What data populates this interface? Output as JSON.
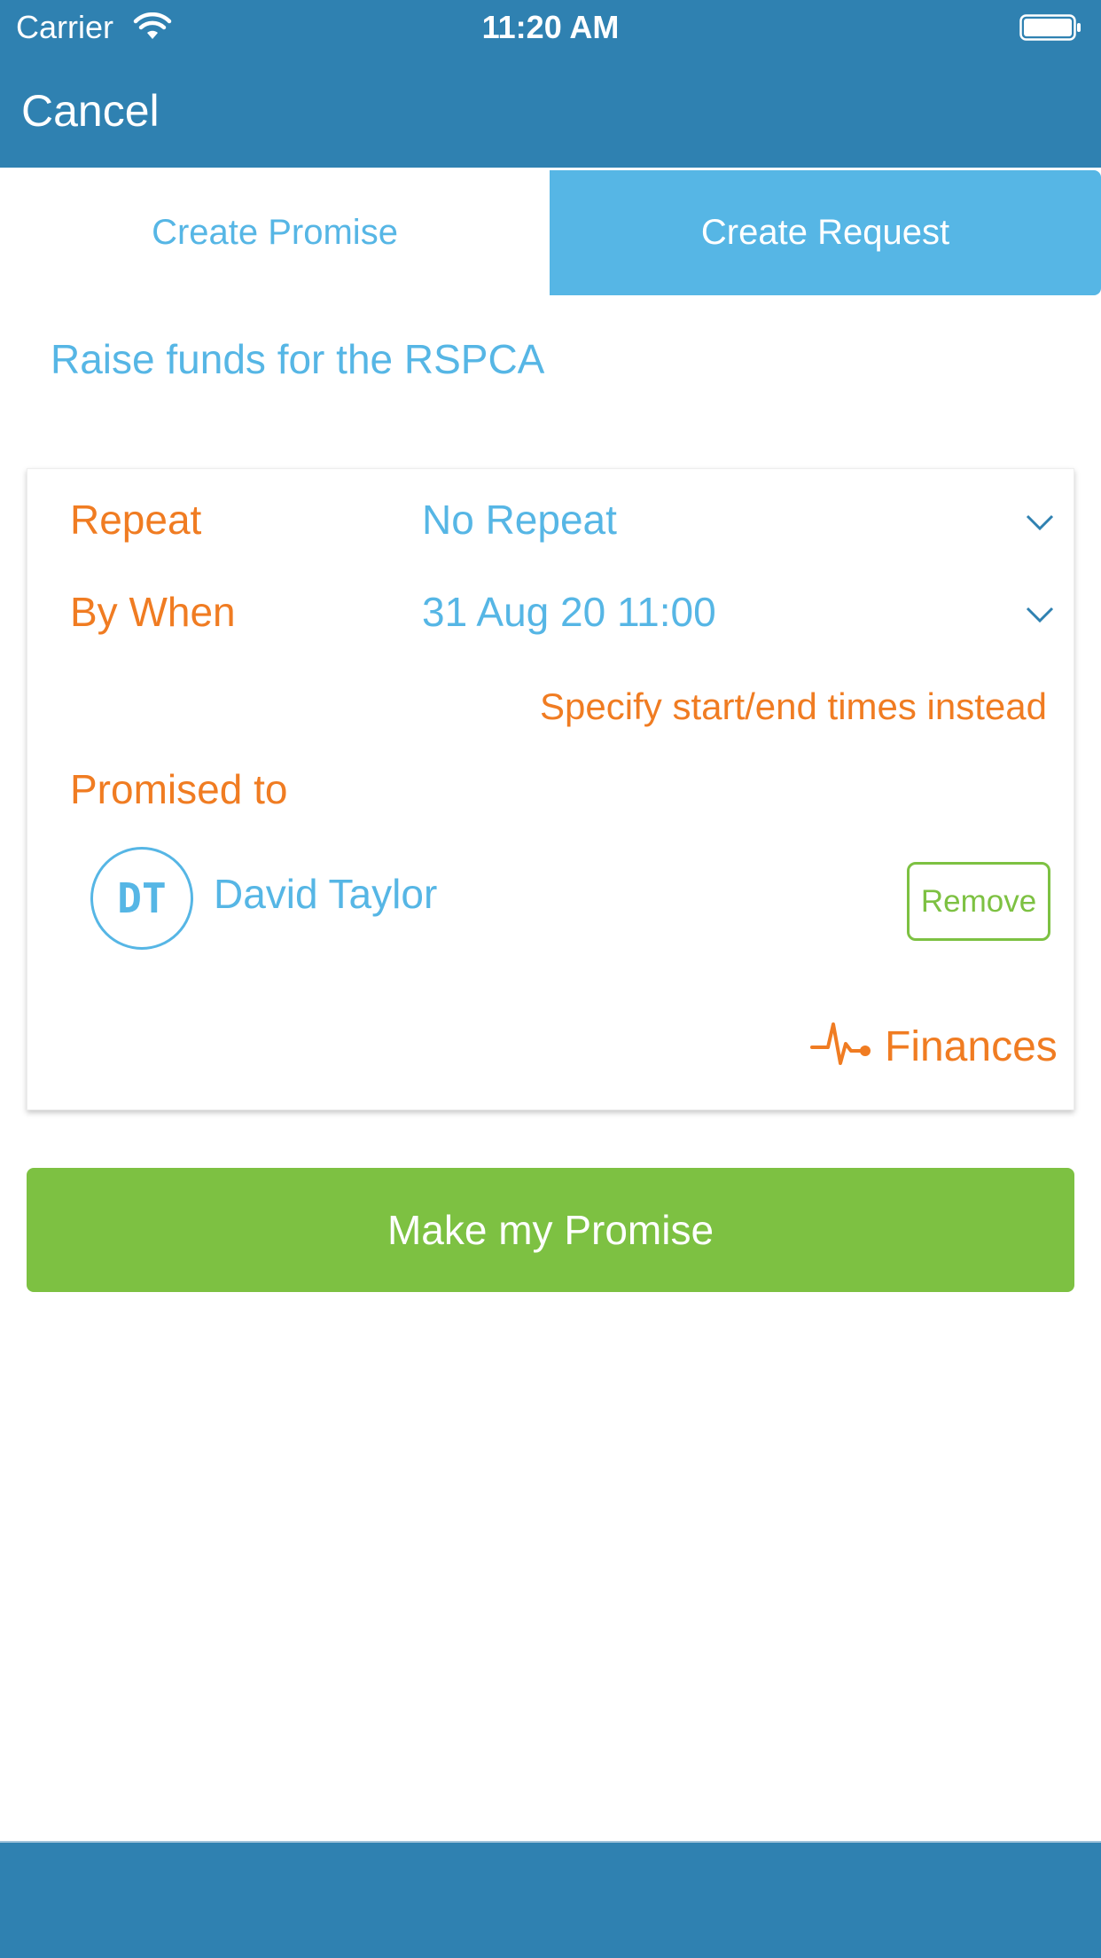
{
  "status_bar": {
    "carrier": "Carrier",
    "time": "11:20 AM"
  },
  "nav": {
    "cancel_label": "Cancel"
  },
  "tabs": [
    {
      "label": "Create Promise",
      "selected": false
    },
    {
      "label": "Create Request",
      "selected": true
    }
  ],
  "promise_title": "Raise funds for the RSPCA",
  "form": {
    "repeat_label": "Repeat",
    "repeat_value": "No Repeat",
    "by_when_label": "By When",
    "by_when_value": "31 Aug 20 11:00",
    "specify_link": "Specify start/end times instead",
    "promised_to_label": "Promised to",
    "recipient": {
      "initials": "DT",
      "name": "David Taylor",
      "remove_label": "Remove"
    },
    "category": {
      "icon": "pulse-icon",
      "label": "Finances"
    }
  },
  "submit_label": "Make my Promise",
  "colors": {
    "nav_blue": "#2f81b1",
    "accent_blue": "#56b6e5",
    "accent_orange": "#f07c22",
    "accent_green": "#7dc142"
  }
}
